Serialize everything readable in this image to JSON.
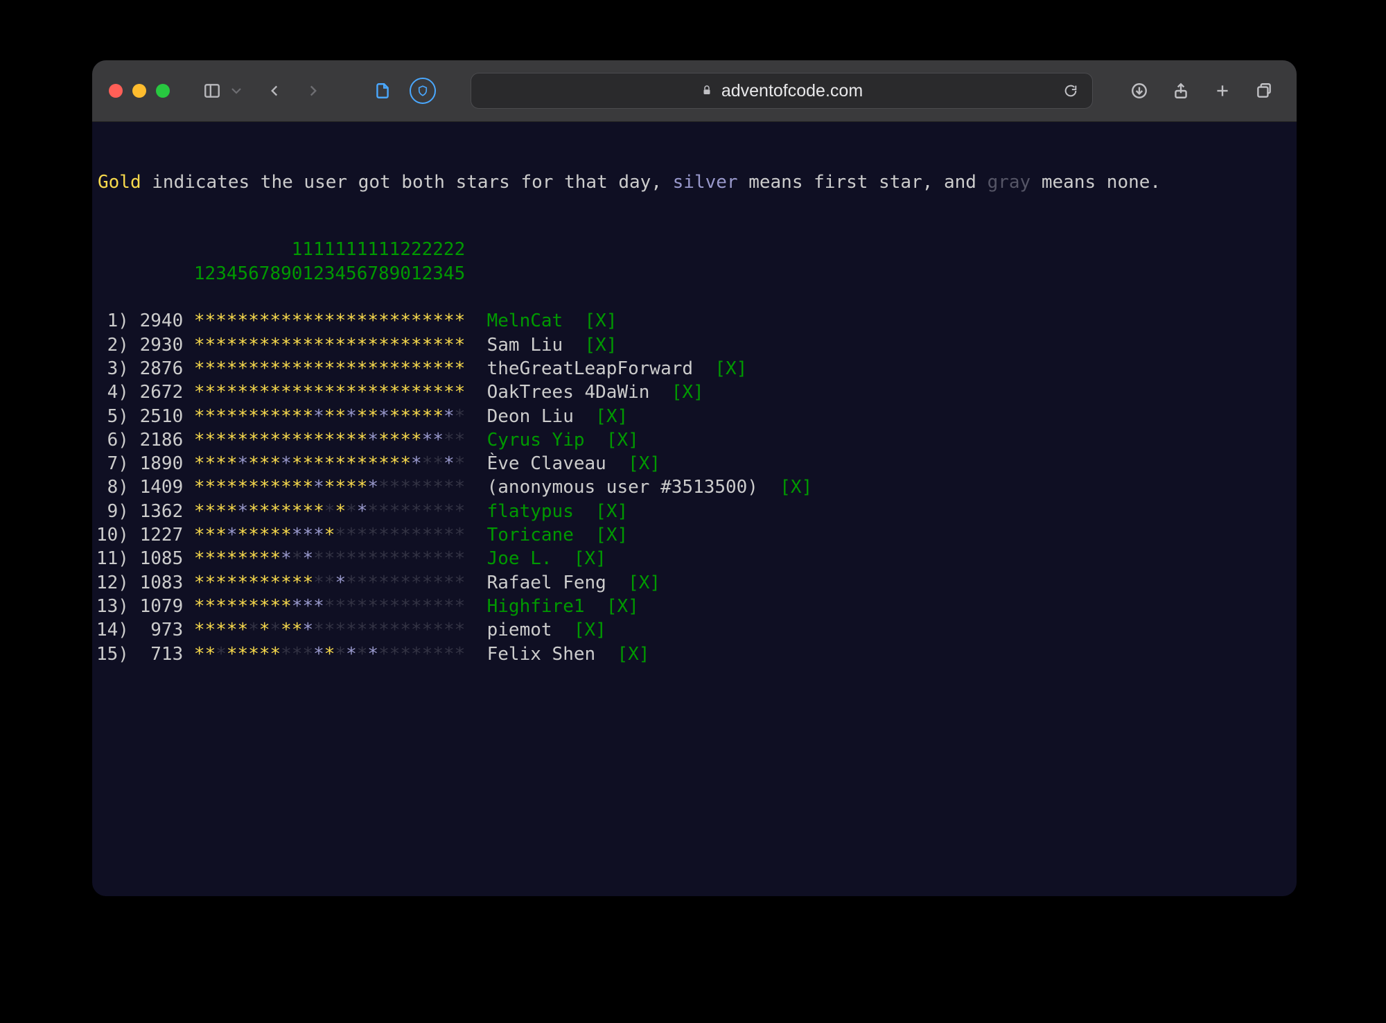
{
  "url": "adventofcode.com",
  "legend": {
    "gold": "Gold",
    "mid1": " indicates the user got both stars for that day, ",
    "silver": "silver",
    "mid2": " means first star, and ",
    "gray": "gray",
    "mid3": " means none."
  },
  "header": {
    "tens": "         1111111111222222",
    "units": "1234567890123456789012345"
  },
  "rows": [
    {
      "rank": " 1)",
      "score": "2940",
      "stars": "ggggggggggggggggggggggggg",
      "name": "MelnCat",
      "nameColor": "green",
      "x": true
    },
    {
      "rank": " 2)",
      "score": "2930",
      "stars": "ggggggggggggggggggggggggg",
      "name": "Sam Liu",
      "nameColor": "",
      "x": true
    },
    {
      "rank": " 3)",
      "score": "2876",
      "stars": "ggggggggggggggggggggggggg",
      "name": "theGreatLeapForward",
      "nameColor": "",
      "x": true
    },
    {
      "rank": " 4)",
      "score": "2672",
      "stars": "ggggggggggggggggggggggggg",
      "name": "OakTrees 4DaWin",
      "nameColor": "",
      "x": true
    },
    {
      "rank": " 5)",
      "score": "2510",
      "stars": "gggggggggggsggsggsgggggsn",
      "name": "Deon Liu",
      "nameColor": "",
      "x": true
    },
    {
      "rank": " 6)",
      "score": "2186",
      "stars": "ggggggggggggggggsggggssnn",
      "name": "Cyrus Yip",
      "nameColor": "green",
      "x": true
    },
    {
      "rank": " 7)",
      "score": "1890",
      "stars": "ggggsgggsgggggggggggsnnsn",
      "name": "Ève Claveau",
      "nameColor": "",
      "x": true
    },
    {
      "rank": " 8)",
      "score": "1409",
      "stars": "gggggggggggsggggsnnnnnnnn",
      "name": "(anonymous user #3513500)",
      "nameColor": "",
      "x": true
    },
    {
      "rank": " 9)",
      "score": "1362",
      "stars": "ggggsgggggggngnsnnnnnnnnn",
      "name": "flatypus",
      "nameColor": "green",
      "x": true
    },
    {
      "rank": "10)",
      "score": "1227",
      "stars": "gggsgggggsssgnnnnnnnnnnnn",
      "name": "Toricane",
      "nameColor": "green",
      "x": true
    },
    {
      "rank": "11)",
      "score": "1085",
      "stars": "ggggggggsnsnnnnnnnnnnnnnn",
      "name": "Joe L.",
      "nameColor": "green",
      "x": true
    },
    {
      "rank": "12)",
      "score": "1083",
      "stars": "gggggggggggnnsnnnnnnnnnnn",
      "name": "Rafael Feng",
      "nameColor": "",
      "x": true
    },
    {
      "rank": "13)",
      "score": "1079",
      "stars": "gggggggggsssnnnnnnnnnnnnn",
      "name": "Highfire1",
      "nameColor": "green",
      "x": true
    },
    {
      "rank": "14)",
      "score": " 973",
      "stars": "gggggngnggsnnnnnnnnnnnnnn",
      "name": "piemot",
      "nameColor": "",
      "x": true
    },
    {
      "rank": "15)",
      "score": " 713",
      "stars": "ggngggggnnnsgnsnsnnnnnnnn",
      "name": "Felix Shen",
      "nameColor": "",
      "x": true
    }
  ]
}
